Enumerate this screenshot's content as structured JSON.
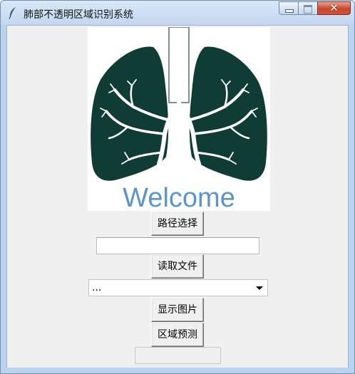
{
  "window": {
    "title": "肺部不透明区域识别系统",
    "controls": {
      "minimize": "minimize-icon",
      "maximize": "maximize-icon",
      "close": "close-icon"
    }
  },
  "banner": {
    "icon": "lungs-icon",
    "welcome_text": "Welcome",
    "colors": {
      "lung": "#0f3d35",
      "trachea": "#ffffff",
      "welcome": "#5b95c9"
    }
  },
  "controls": {
    "select_path_label": "路径选择",
    "path_value": "",
    "read_file_label": "读取文件",
    "file_select_value": "...",
    "show_image_label": "显示图片",
    "predict_region_label": "区域预测",
    "result_value": ""
  }
}
